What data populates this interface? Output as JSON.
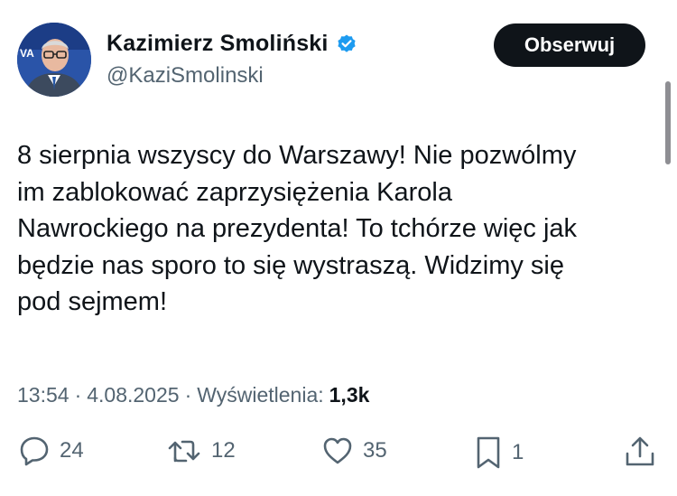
{
  "author": {
    "name": "Kazimierz Smoliński",
    "handle": "@KaziSmolinski",
    "avatar_text": "VA",
    "verified_color": "#1d9bf0"
  },
  "header": {
    "follow_label": "Obserwuj"
  },
  "tweet": {
    "text": "8 sierpnia wszyscy do Warszawy! Nie pozwólmy\nim zablokować zaprzysiężenia Karola\nNawrockiego na prezydenta! To tchórze więc jak\nbędzie nas sporo to się wystraszą. Widzimy się\npod sejmem!",
    "time": "13:54",
    "date": "4.08.2025",
    "views_label": "Wyświetlenia:",
    "views_count": "1,3k",
    "separator": "·"
  },
  "actions": {
    "replies": "24",
    "reposts": "12",
    "likes": "35",
    "bookmarks": "1",
    "icons": [
      "reply-icon",
      "repost-icon",
      "like-icon",
      "bookmark-icon",
      "share-icon"
    ]
  }
}
